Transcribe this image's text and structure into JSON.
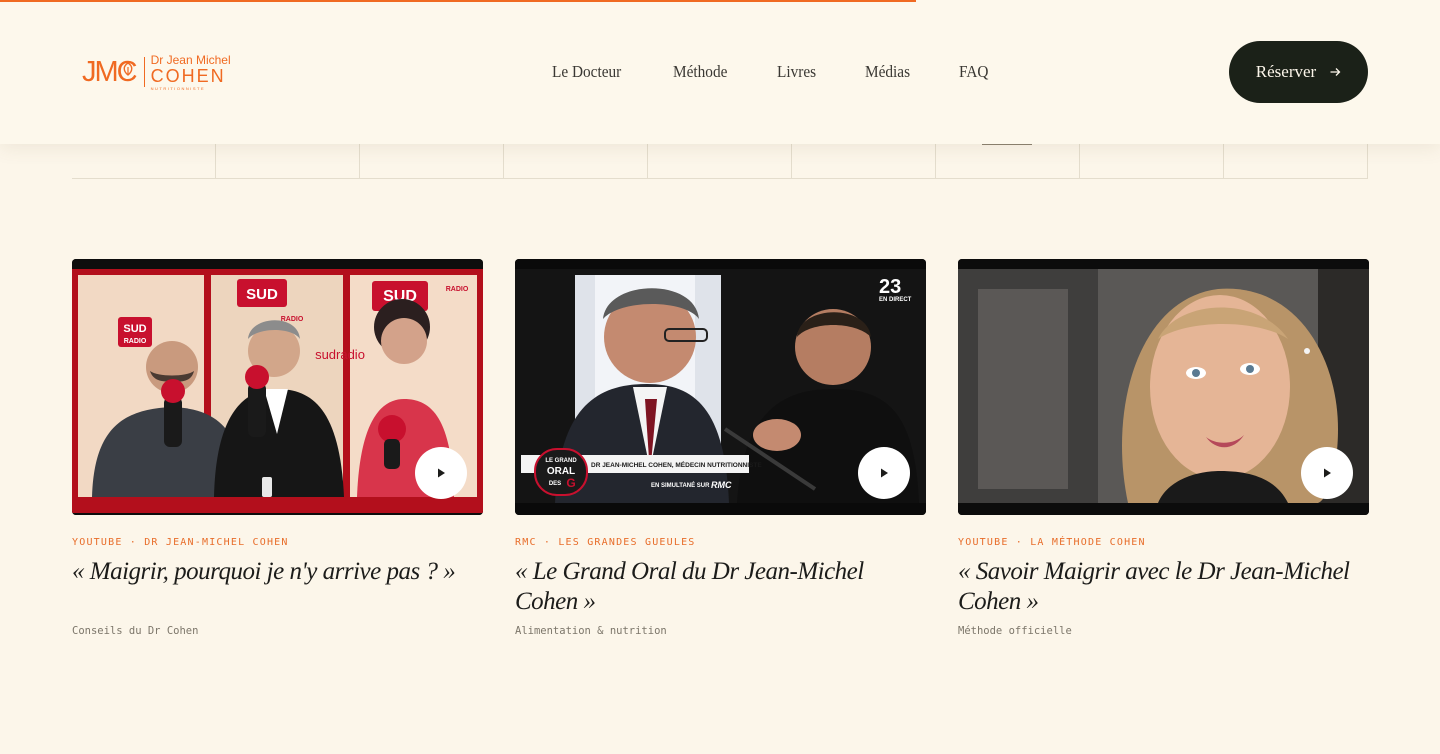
{
  "brand": {
    "monogram": "JMC",
    "title_top": "Dr Jean Michel",
    "title_main": "COHEN",
    "subtitle": "NUTRITIONNISTE",
    "accent_color": "#f06a22"
  },
  "nav": {
    "items": [
      {
        "label": "Le Docteur"
      },
      {
        "label": "Méthode"
      },
      {
        "label": "Livres"
      },
      {
        "label": "Médias"
      },
      {
        "label": "FAQ"
      }
    ],
    "cta_label": "Réserver",
    "cta_icon": "arrow-right-icon"
  },
  "media": {
    "cards": [
      {
        "meta": "YOUTUBE · DR JEAN-MICHEL COHEN",
        "title": "« Maigrir, pourquoi je n'y arrive pas ? »",
        "tag": "Conseils du Dr Cohen",
        "thumb_texts": [
          "SUD",
          "RADIO",
          "SUD",
          "RADIO",
          "SUD",
          "RADIO",
          "sudradio"
        ]
      },
      {
        "meta": "RMC · LES GRANDES GUEULES",
        "title": "« Le Grand Oral du Dr Jean-Michel Cohen »",
        "tag": "Alimentation & nutrition",
        "thumb_texts": [
          "23",
          "EN DIRECT",
          "LE GRAND",
          "ORAL",
          "DES",
          "G",
          "DR JEAN-MICHEL COHEN, MÉDECIN NUTRITIONNISTE",
          "EN SIMULTANÉ SUR",
          "RMC"
        ]
      },
      {
        "meta": "YOUTUBE · LA MÉTHODE COHEN",
        "title": "« Savoir Maigrir avec le Dr Jean-Michel Cohen »",
        "tag": "Méthode officielle",
        "thumb_texts": []
      }
    ],
    "play_icon": "play-icon"
  }
}
